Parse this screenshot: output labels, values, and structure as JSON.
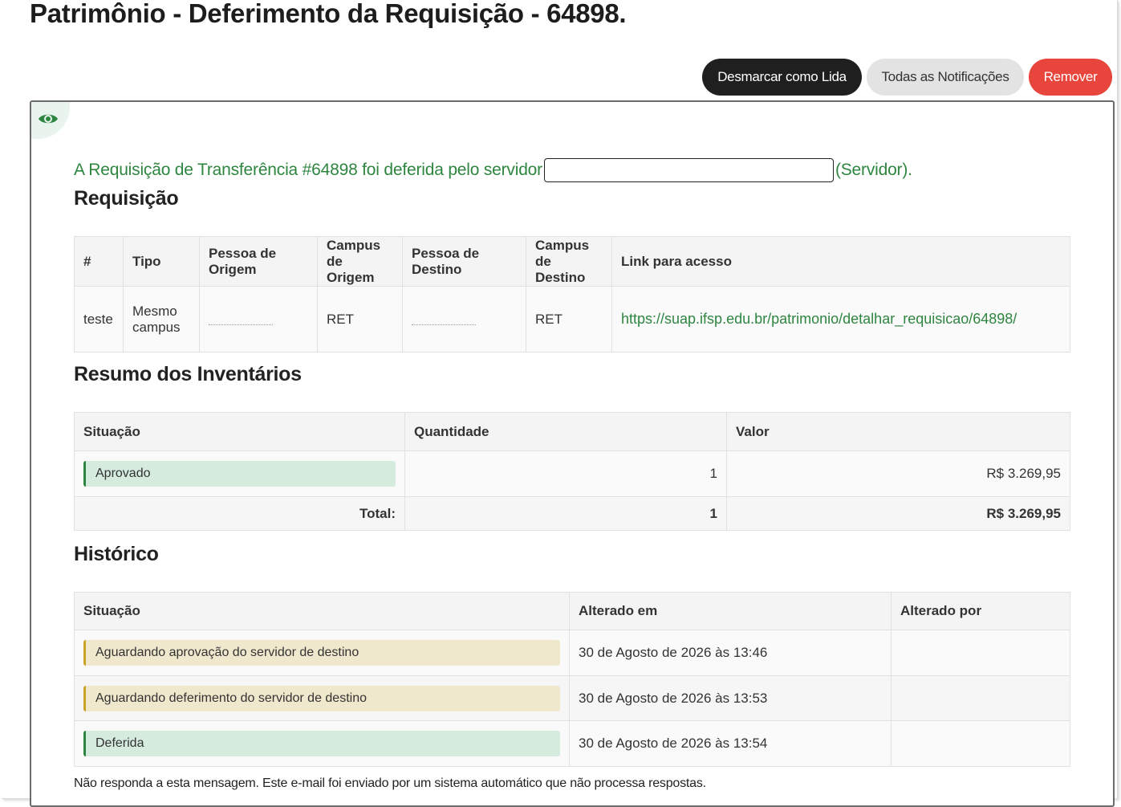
{
  "page": {
    "title": "Patrimônio - Deferimento da Requisição - 64898."
  },
  "actions": {
    "mark_unread": "Desmarcar como Lida",
    "all_notifications": "Todas as Notificações",
    "remove": "Remover"
  },
  "message": {
    "intro_before": "A Requisição de Transferência #64898 foi deferida pelo servidor",
    "intro_after": "(Servidor)."
  },
  "requisicao": {
    "heading": "Requisição",
    "columns": [
      "#",
      "Tipo",
      "Pessoa de Origem",
      "Campus de Origem",
      "Pessoa de Destino",
      "Campus de Destino",
      "Link para acesso"
    ],
    "row": {
      "id": "teste",
      "tipo": "Mesmo campus",
      "pessoa_origem": "",
      "campus_origem": "RET",
      "pessoa_destino": "",
      "campus_destino": "RET",
      "link": "https://suap.ifsp.edu.br/patrimonio/detalhar_requisicao/64898/"
    }
  },
  "inventarios": {
    "heading": "Resumo dos Inventários",
    "columns": [
      "Situação",
      "Quantidade",
      "Valor"
    ],
    "rows": [
      {
        "situacao": "Aprovado",
        "quantidade": "1",
        "valor": "R$ 3.269,95"
      }
    ],
    "total": {
      "label": "Total:",
      "quantidade": "1",
      "valor": "R$ 3.269,95"
    }
  },
  "historico": {
    "heading": "Histórico",
    "columns": [
      "Situação",
      "Alterado em",
      "Alterado por"
    ],
    "rows": [
      {
        "situacao": "Aguardando aprovação do servidor de destino",
        "alterado_em": "30 de Agosto de 2026 às 13:46",
        "alterado_por": "",
        "tone": "yellow"
      },
      {
        "situacao": "Aguardando deferimento do servidor de destino",
        "alterado_em": "30 de Agosto de 2026 às 13:53",
        "alterado_por": "",
        "tone": "yellow"
      },
      {
        "situacao": "Deferida",
        "alterado_em": "30 de Agosto de 2026 às 13:54",
        "alterado_por": "",
        "tone": "green"
      }
    ]
  },
  "footer": {
    "note": "Não responda a esta mensagem. Este e-mail foi enviado por um sistema automático que não processa respostas."
  },
  "colors": {
    "accent_green": "#2e8540",
    "danger": "#e8453c",
    "dark_button": "#1f1f1f"
  },
  "icons": {
    "read_status": "eye-icon"
  }
}
